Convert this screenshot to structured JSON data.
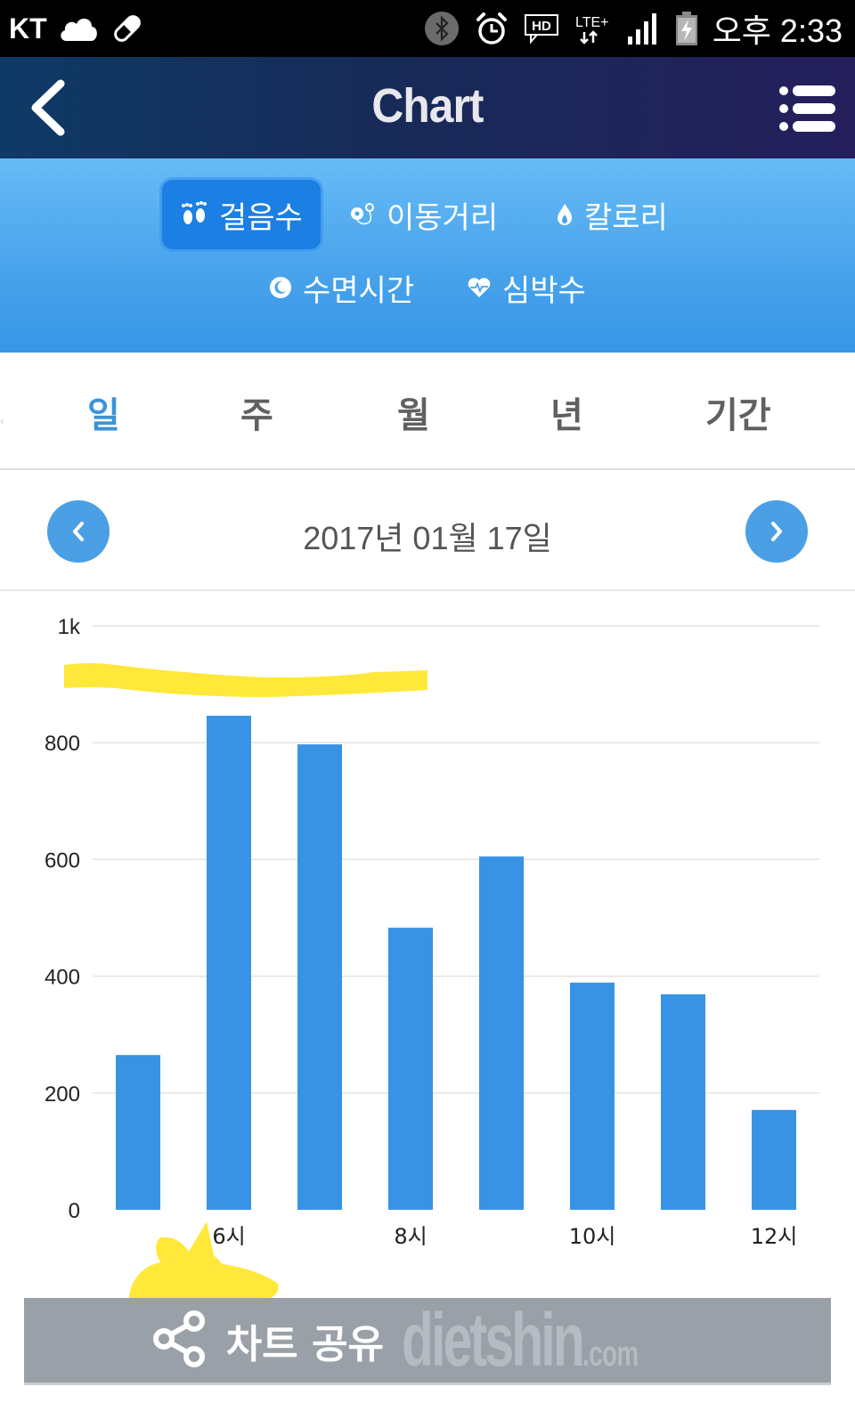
{
  "status_bar": {
    "carrier": "KT",
    "left_icons": [
      "cloud-icon",
      "pill-icon"
    ],
    "right_icons": [
      "bluetooth-icon",
      "alarm-icon",
      "hd-voice-icon",
      "lte-plus-icon",
      "signal-icon",
      "battery-charging-icon"
    ],
    "lte_label": "LTE+",
    "hd_label": "HD",
    "time": "오후 2:33"
  },
  "header": {
    "title": "Chart",
    "back_icon": "chevron-left-icon",
    "menu_icon": "list-menu-icon"
  },
  "metric_tabs": [
    {
      "label": "걸음수",
      "icon": "footprints-icon",
      "active": true
    },
    {
      "label": "이동거리",
      "icon": "route-pin-icon",
      "active": false
    },
    {
      "label": "칼로리",
      "icon": "flame-icon",
      "active": false
    },
    {
      "label": "수면시간",
      "icon": "moon-icon",
      "active": false
    },
    {
      "label": "심박수",
      "icon": "heart-pulse-icon",
      "active": false
    }
  ],
  "period_tabs": [
    {
      "label": "일",
      "active": true
    },
    {
      "label": "주",
      "active": false
    },
    {
      "label": "월",
      "active": false
    },
    {
      "label": "년",
      "active": false
    },
    {
      "label": "기간",
      "active": false
    }
  ],
  "date_nav": {
    "date": "2017년 01월 17일",
    "prev_icon": "chevron-left-icon",
    "next_icon": "chevron-right-icon"
  },
  "colors": {
    "bar": "#3893e5",
    "accent": "#4b9fe4",
    "active_tab_text": "#3d93d6",
    "grid": "#e3e3e3",
    "share_button": "#9aa0a7",
    "highlighter": "#ffe83a"
  },
  "chart_data": {
    "type": "bar",
    "title": "",
    "xlabel": "",
    "ylabel": "",
    "categories": [
      "5시",
      "6시",
      "7시",
      "8시",
      "9시",
      "10시",
      "11시",
      "12시"
    ],
    "x_tick_labels": [
      "",
      "6시",
      "",
      "8시",
      "",
      "10시",
      "",
      "12시"
    ],
    "values": [
      265,
      846,
      797,
      483,
      605,
      389,
      369,
      171
    ],
    "y_ticks": [
      0,
      200,
      400,
      600,
      800,
      1000
    ],
    "y_tick_labels": [
      "0",
      "200",
      "400",
      "600",
      "800",
      "1k"
    ],
    "ylim": [
      0,
      1000
    ],
    "grid": true,
    "legend": "none"
  },
  "share": {
    "label": "차트 공유",
    "icon": "share-icon",
    "watermark": "dietshin",
    "watermark_suffix": ".com"
  }
}
